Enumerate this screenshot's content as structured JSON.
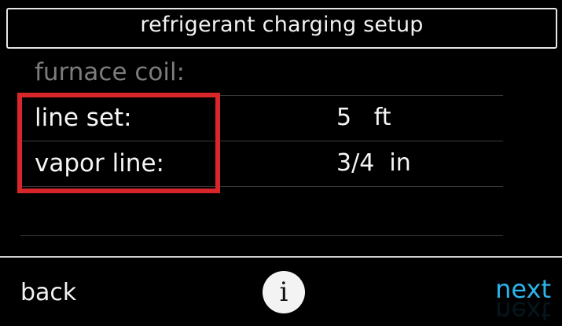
{
  "header": {
    "title": "refrigerant charging setup"
  },
  "rows": [
    {
      "label": "furnace coil:",
      "value": "",
      "state": "disabled"
    },
    {
      "label": "line set:",
      "value": "5   ft"
    },
    {
      "label": "vapor line:",
      "value": "3/4  in"
    },
    {
      "label": "",
      "value": ""
    }
  ],
  "footer": {
    "back_label": "back",
    "info_icon": "i",
    "next_label": "next"
  },
  "colors": {
    "accent": "#2bb3ea",
    "highlight": "#d9262b",
    "background": "#000000",
    "disabled_text": "#7c7c7c"
  }
}
